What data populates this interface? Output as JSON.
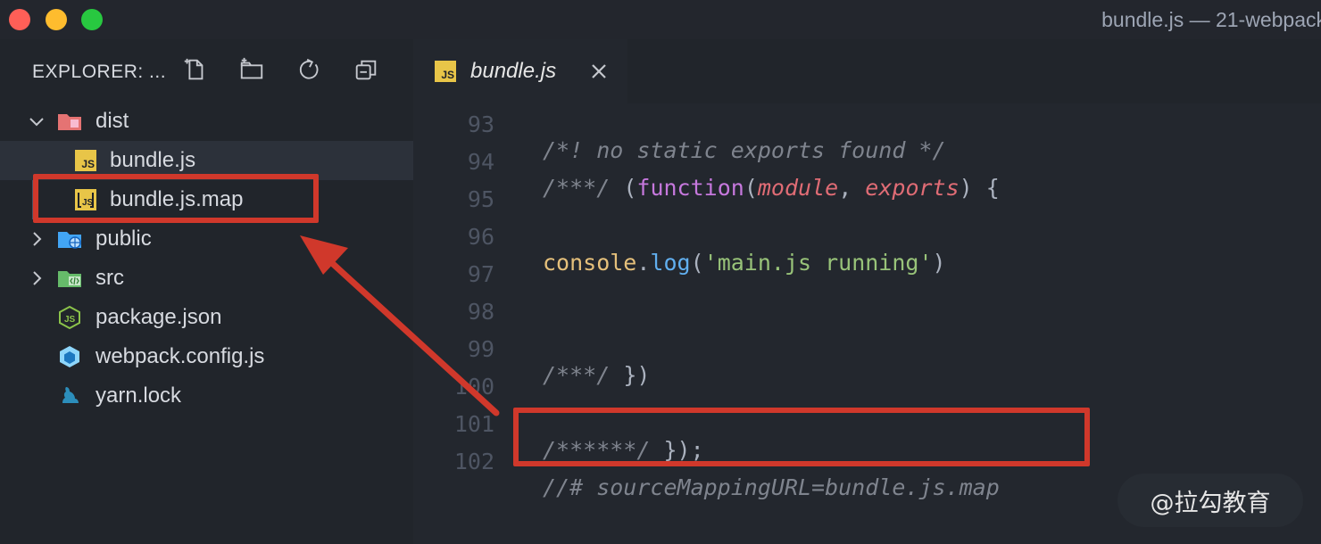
{
  "window": {
    "title": "bundle.js — 21-webpack"
  },
  "sidebar": {
    "title": "EXPLORER: ...",
    "toolbar": [
      "new-file-icon",
      "new-folder-icon",
      "refresh-icon",
      "collapse-all-icon"
    ],
    "tree": [
      {
        "label": "dist",
        "kind": "folder-open",
        "icon": "folder-dist-icon"
      },
      {
        "label": "bundle.js",
        "kind": "file",
        "icon": "js-file-icon",
        "selected": true
      },
      {
        "label": "bundle.js.map",
        "kind": "file",
        "icon": "js-map-file-icon"
      },
      {
        "label": "public",
        "kind": "folder",
        "icon": "folder-public-icon"
      },
      {
        "label": "src",
        "kind": "folder",
        "icon": "folder-src-icon"
      },
      {
        "label": "package.json",
        "kind": "file",
        "icon": "nodejs-icon"
      },
      {
        "label": "webpack.config.js",
        "kind": "file",
        "icon": "webpack-icon"
      },
      {
        "label": "yarn.lock",
        "kind": "file",
        "icon": "yarn-icon"
      }
    ]
  },
  "editor": {
    "tab": {
      "label": "bundle.js",
      "icon": "js-file-icon"
    },
    "lines": [
      {
        "num": "93",
        "text": "/*! no static exports found */"
      },
      {
        "num": "94",
        "text": "/***/ (function(module, exports) {"
      },
      {
        "num": "95",
        "text": ""
      },
      {
        "num": "96",
        "text": "console.log('main.js running')"
      },
      {
        "num": "97",
        "text": ""
      },
      {
        "num": "98",
        "text": ""
      },
      {
        "num": "99",
        "text": "/***/ })"
      },
      {
        "num": "100",
        "text": ""
      },
      {
        "num": "101",
        "text": "/******/ });"
      },
      {
        "num": "102",
        "text": "//# sourceMappingURL=bundle.js.map"
      }
    ]
  },
  "watermark": "@拉勾教育",
  "colors": {
    "annotation": "#d0382b",
    "js_badge": "#e8c548"
  }
}
